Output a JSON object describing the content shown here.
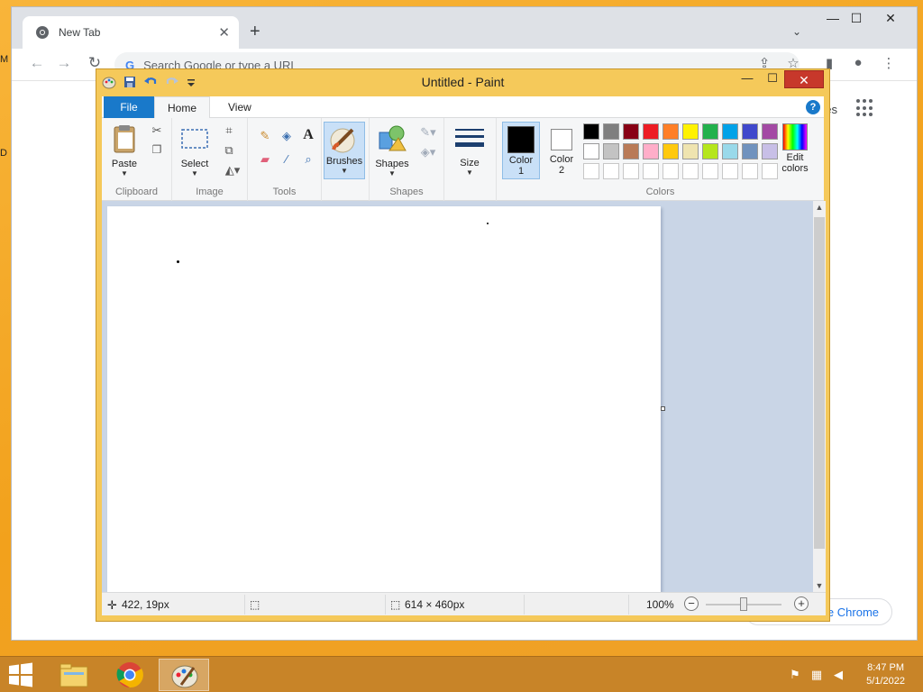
{
  "desktop": {
    "edge_text_top": "M",
    "edge_text_mid": "D"
  },
  "chrome": {
    "tab_title": "New Tab",
    "tab_close": "✕",
    "new_tab": "+",
    "tabs_dropdown": "⌄",
    "minimize": "—",
    "maximize": "☐",
    "close": "✕",
    "back": "←",
    "forward": "→",
    "reload": "↻",
    "omnibox_placeholder": "Search Google or type a URL",
    "google_g": "G",
    "share_icon": "⇪",
    "bookmark_icon": "☆",
    "sidebar_icon": "▮",
    "profile_icon": "●",
    "menu_icon": "⋮",
    "right_text": "ges",
    "customize_label": "e Chrome"
  },
  "paint": {
    "title": "Untitled - Paint",
    "minimize": "—",
    "maximize": "☐",
    "close": "✕",
    "tabs": {
      "file": "File",
      "home": "Home",
      "view": "View"
    },
    "help": "?",
    "groups": {
      "clipboard": "Clipboard",
      "image": "Image",
      "tools": "Tools",
      "shapes": "Shapes",
      "colors": "Colors"
    },
    "buttons": {
      "paste": "Paste",
      "select": "Select",
      "brushes": "Brushes",
      "shapes": "Shapes",
      "size": "Size",
      "color1": "Color",
      "color1_num": "1",
      "color2": "Color",
      "color2_num": "2",
      "edit_colors_1": "Edit",
      "edit_colors_2": "colors"
    },
    "palette": [
      "#000000",
      "#7f7f7f",
      "#880015",
      "#ed1c24",
      "#ff7f27",
      "#fff200",
      "#22b14c",
      "#00a2e8",
      "#3f48cc",
      "#a349a4",
      "#ffffff",
      "#c3c3c3",
      "#b97a57",
      "#ffaec9",
      "#ffc90e",
      "#efe4b0",
      "#b5e61d",
      "#99d9ea",
      "#7092be",
      "#c8bfe7"
    ],
    "color1_value": "#000000",
    "color2_value": "#ffffff",
    "status": {
      "cursor_pos": "422, 19px",
      "canvas_size": "614 × 460px",
      "zoom": "100%",
      "zoom_fraction": 0.5
    }
  },
  "taskbar": {
    "time": "8:47 PM",
    "date": "5/1/2022"
  }
}
